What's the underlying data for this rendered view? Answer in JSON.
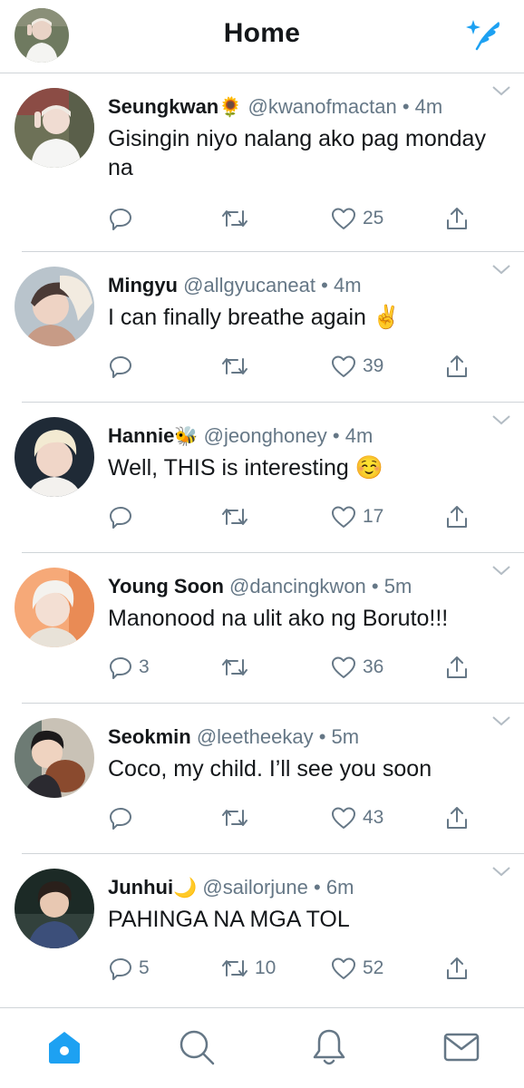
{
  "header": {
    "title": "Home",
    "profile_icon": "user-avatar",
    "compose_icon": "compose-feather-icon",
    "accent_color": "#1da1f2"
  },
  "tweets": [
    {
      "name": "Seungkwan",
      "emoji": "🌻",
      "handle": "@kwanofmactan",
      "time": "4m",
      "text": "Gisingin niyo nalang ako pag monday na",
      "replies": "",
      "retweets": "",
      "likes": "25"
    },
    {
      "name": "Mingyu",
      "emoji": "",
      "handle": "@allgyucaneat",
      "time": "4m",
      "text": "I can finally breathe again ✌️",
      "replies": "",
      "retweets": "",
      "likes": "39"
    },
    {
      "name": "Hannie",
      "emoji": "🐝",
      "handle": "@jeonghoney",
      "time": "4m",
      "text": "Well, THIS is interesting ☺️",
      "replies": "",
      "retweets": "",
      "likes": "17"
    },
    {
      "name": "Young Soon",
      "emoji": "",
      "handle": "@dancingkwon",
      "time": "5m",
      "text": "Manonood na ulit ako ng Boruto!!!",
      "replies": "3",
      "retweets": "",
      "likes": "36"
    },
    {
      "name": "Seokmin",
      "emoji": "",
      "handle": "@leetheekay",
      "time": "5m",
      "text": "Coco, my child. I’ll see you soon",
      "replies": "",
      "retweets": "",
      "likes": "43"
    },
    {
      "name": "Junhui",
      "emoji": "🌙",
      "handle": "@sailorjune",
      "time": "6m",
      "text": "PAHINGA NA MGA TOL",
      "replies": "5",
      "retweets": "10",
      "likes": "52"
    }
  ],
  "separator": "•",
  "bottom_nav": {
    "items": [
      "home-icon",
      "search-icon",
      "notifications-bell-icon",
      "messages-envelope-icon"
    ],
    "active": "home-icon"
  }
}
